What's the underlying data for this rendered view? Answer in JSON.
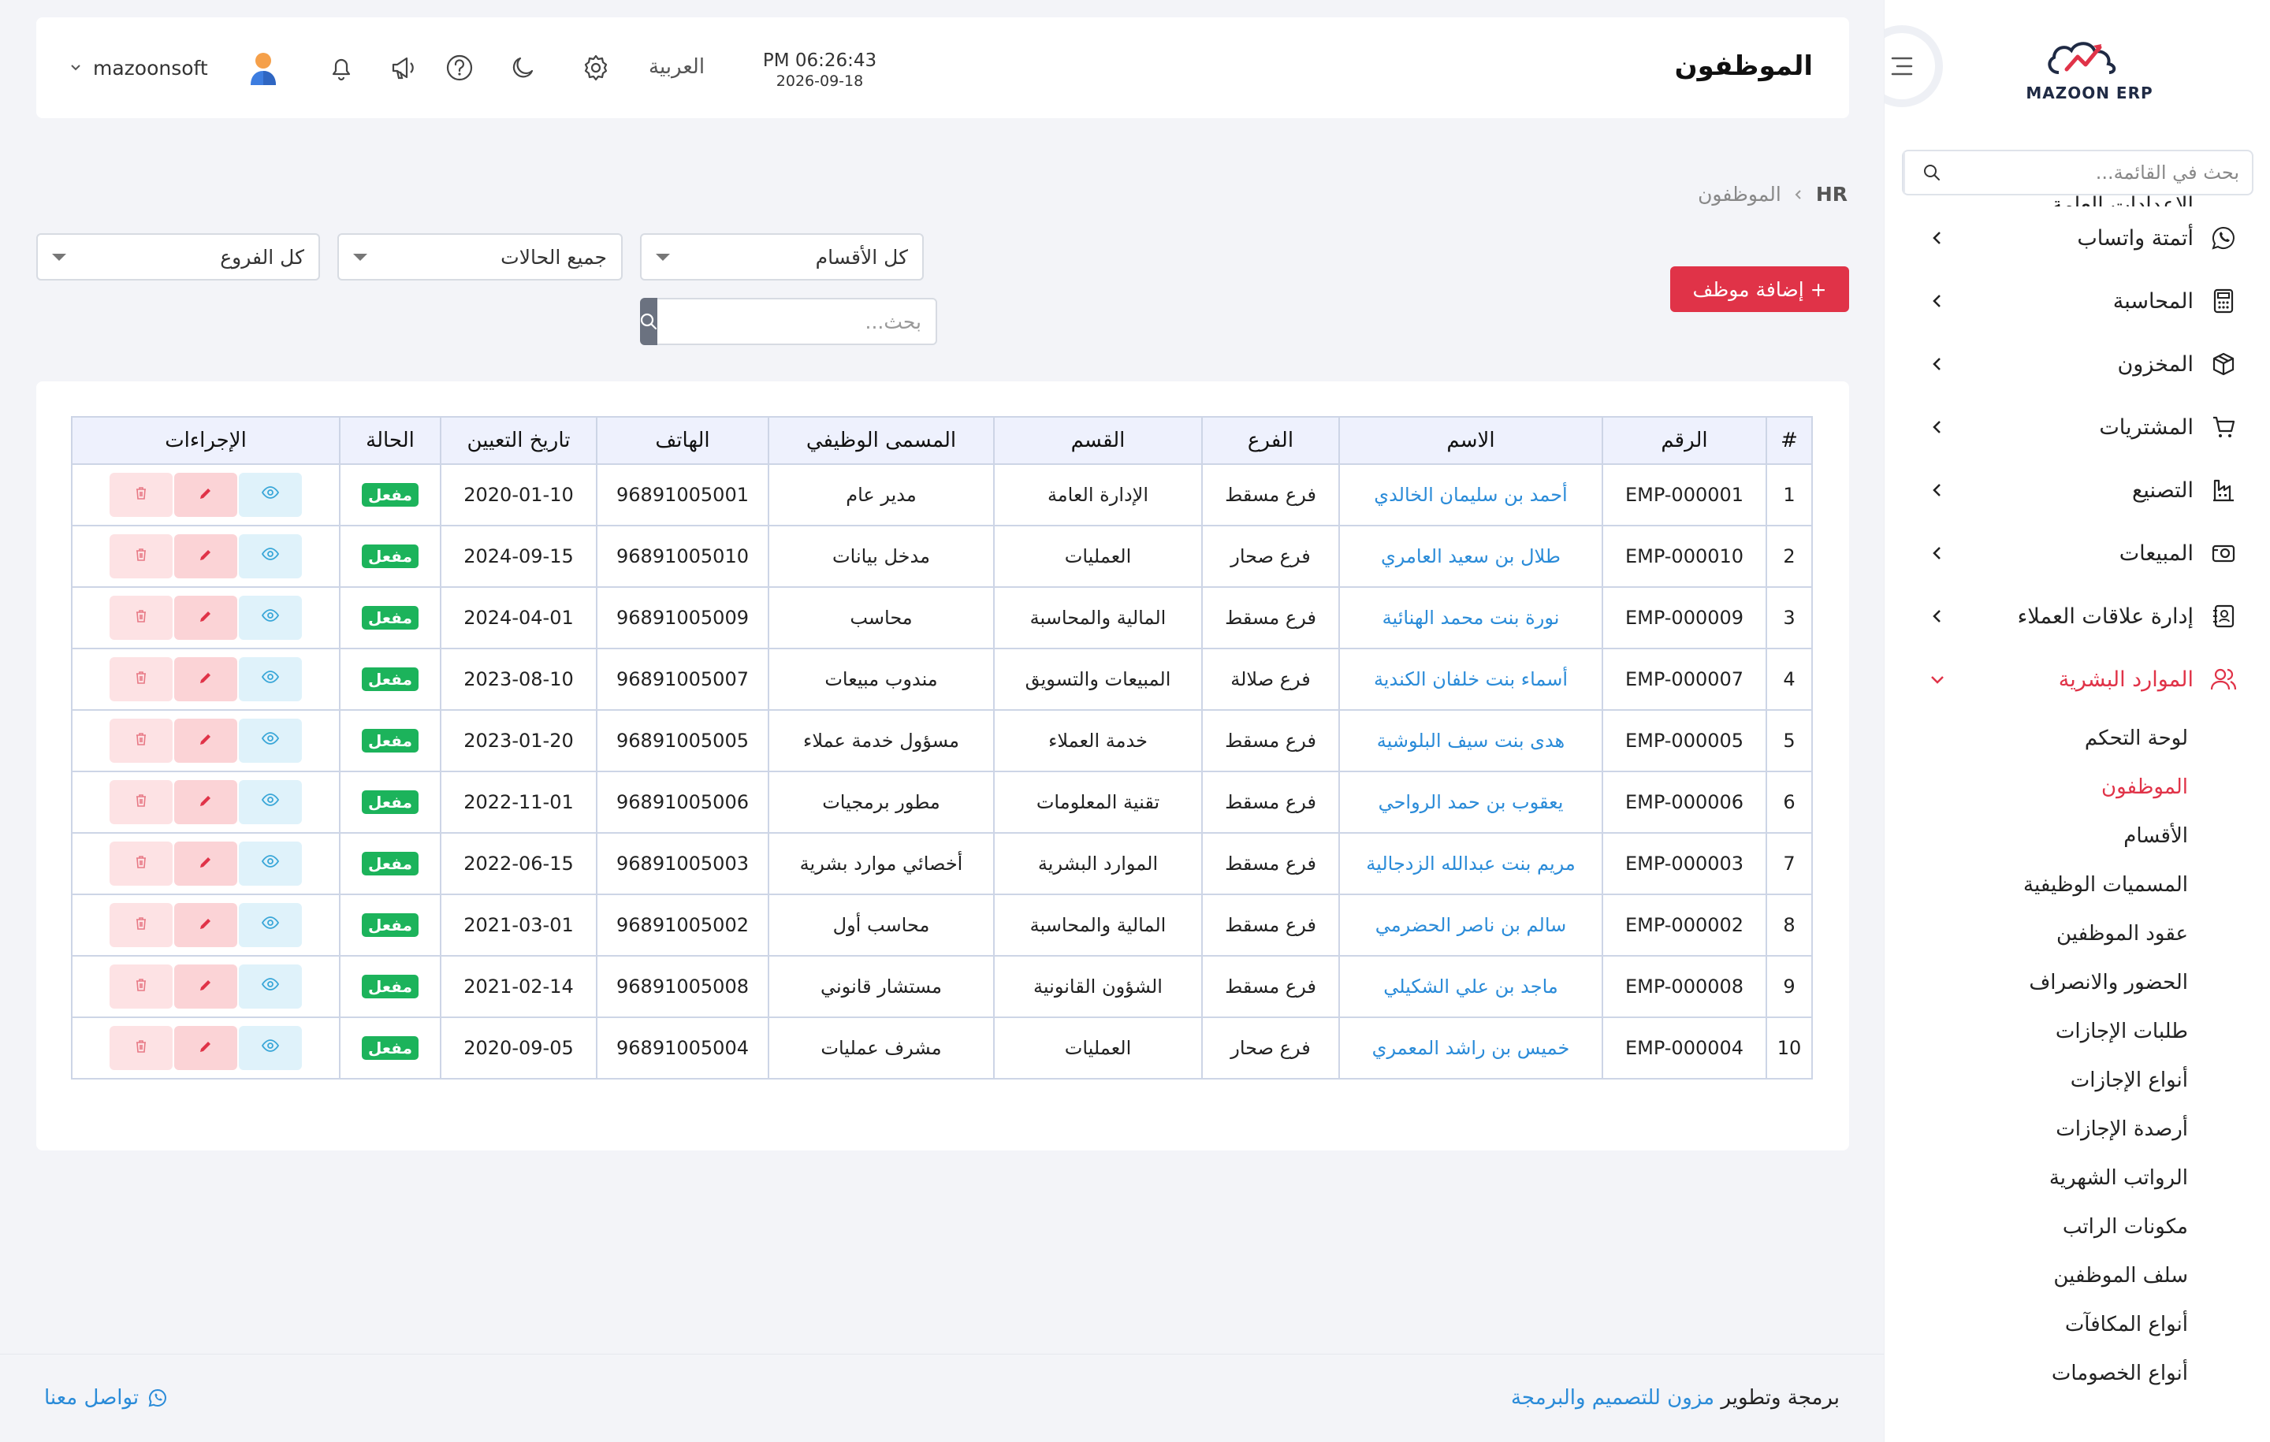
{
  "sidebar": {
    "logo_text": "MAZOON ERP",
    "search_placeholder": "بحث في القائمة...",
    "partial_item": "الإعدادات العامة",
    "items": [
      {
        "label": "أتمتة واتساب",
        "icon": "whatsapp-icon"
      },
      {
        "label": "المحاسبة",
        "icon": "calculator-icon"
      },
      {
        "label": "المخزون",
        "icon": "box-icon"
      },
      {
        "label": "المشتريات",
        "icon": "cart-icon"
      },
      {
        "label": "التصنيع",
        "icon": "factory-icon"
      },
      {
        "label": "المبيعات",
        "icon": "sales-icon"
      },
      {
        "label": "إدارة علاقات العملاء",
        "icon": "contacts-icon"
      },
      {
        "label": "الموارد البشرية",
        "icon": "users-icon",
        "active": true
      }
    ],
    "submenu": [
      "لوحة التحكم",
      "الموظفون",
      "الأقسام",
      "المسميات الوظيفية",
      "عقود الموظفين",
      "الحضور والانصراف",
      "طلبات الإجازات",
      "أنواع الإجازات",
      "أرصدة الإجازات",
      "الرواتب الشهرية",
      "مكونات الراتب",
      "سلف الموظفين",
      "أنواع المكافآت",
      "أنواع الخصومات"
    ],
    "active_submenu": "الموظفون"
  },
  "header": {
    "title": "الموظفون",
    "time": "PM 06:26:43",
    "date": "2026-09-18",
    "language": "العربية",
    "username": "mazoonsoft"
  },
  "breadcrumb": {
    "root": "HR",
    "current": "الموظفون"
  },
  "filters": {
    "departments": "كل الأقسام",
    "statuses": "جميع الحالات",
    "branches": "كل الفروع",
    "search_placeholder": "بحث..."
  },
  "add_button": "+ إضافة موظف",
  "table": {
    "headers": [
      "#",
      "الرقم",
      "الاسم",
      "الفرع",
      "القسم",
      "المسمى الوظيفي",
      "الهاتف",
      "تاريخ التعيين",
      "الحالة",
      "الإجراءات"
    ],
    "rows": [
      {
        "n": "1",
        "code": "EMP-000001",
        "name": "أحمد بن سليمان الخالدي",
        "branch": "فرع مسقط",
        "dept": "الإدارة العامة",
        "title": "مدير عام",
        "phone": "96891005001",
        "date": "2020-01-10",
        "status": "مفعل"
      },
      {
        "n": "2",
        "code": "EMP-000010",
        "name": "طلال بن سعيد العامري",
        "branch": "فرع صحار",
        "dept": "العمليات",
        "title": "مدخل بيانات",
        "phone": "96891005010",
        "date": "2024-09-15",
        "status": "مفعل"
      },
      {
        "n": "3",
        "code": "EMP-000009",
        "name": "نورة بنت محمد الهنائية",
        "branch": "فرع مسقط",
        "dept": "المالية والمحاسبة",
        "title": "محاسب",
        "phone": "96891005009",
        "date": "2024-04-01",
        "status": "مفعل"
      },
      {
        "n": "4",
        "code": "EMP-000007",
        "name": "أسماء بنت خلفان الكندية",
        "branch": "فرع صلالة",
        "dept": "المبيعات والتسويق",
        "title": "مندوب مبيعات",
        "phone": "96891005007",
        "date": "2023-08-10",
        "status": "مفعل"
      },
      {
        "n": "5",
        "code": "EMP-000005",
        "name": "هدى بنت سيف البلوشية",
        "branch": "فرع مسقط",
        "dept": "خدمة العملاء",
        "title": "مسؤول خدمة عملاء",
        "phone": "96891005005",
        "date": "2023-01-20",
        "status": "مفعل"
      },
      {
        "n": "6",
        "code": "EMP-000006",
        "name": "يعقوب بن حمد الرواحي",
        "branch": "فرع مسقط",
        "dept": "تقنية المعلومات",
        "title": "مطور برمجيات",
        "phone": "96891005006",
        "date": "2022-11-01",
        "status": "مفعل"
      },
      {
        "n": "7",
        "code": "EMP-000003",
        "name": "مريم بنت عبدالله الزدجالية",
        "branch": "فرع مسقط",
        "dept": "الموارد البشرية",
        "title": "أخصائي موارد بشرية",
        "phone": "96891005003",
        "date": "2022-06-15",
        "status": "مفعل"
      },
      {
        "n": "8",
        "code": "EMP-000002",
        "name": "سالم بن ناصر الحضرمي",
        "branch": "فرع مسقط",
        "dept": "المالية والمحاسبة",
        "title": "محاسب أول",
        "phone": "96891005002",
        "date": "2021-03-01",
        "status": "مفعل"
      },
      {
        "n": "9",
        "code": "EMP-000008",
        "name": "ماجد بن علي الشكيلي",
        "branch": "فرع مسقط",
        "dept": "الشؤون القانونية",
        "title": "مستشار قانوني",
        "phone": "96891005008",
        "date": "2021-02-14",
        "status": "مفعل"
      },
      {
        "n": "10",
        "code": "EMP-000004",
        "name": "خميس بن راشد المعمري",
        "branch": "فرع صحار",
        "dept": "العمليات",
        "title": "مشرف عمليات",
        "phone": "96891005004",
        "date": "2020-09-05",
        "status": "مفعل"
      }
    ]
  },
  "footer": {
    "credit_prefix": "برمجة وتطوير",
    "credit_company": "مزون للتصميم والبرمجة",
    "contact": "تواصل معنا"
  },
  "colors": {
    "accent": "#e03348",
    "link": "#2a8bd8",
    "badge": "#1cb35b"
  }
}
